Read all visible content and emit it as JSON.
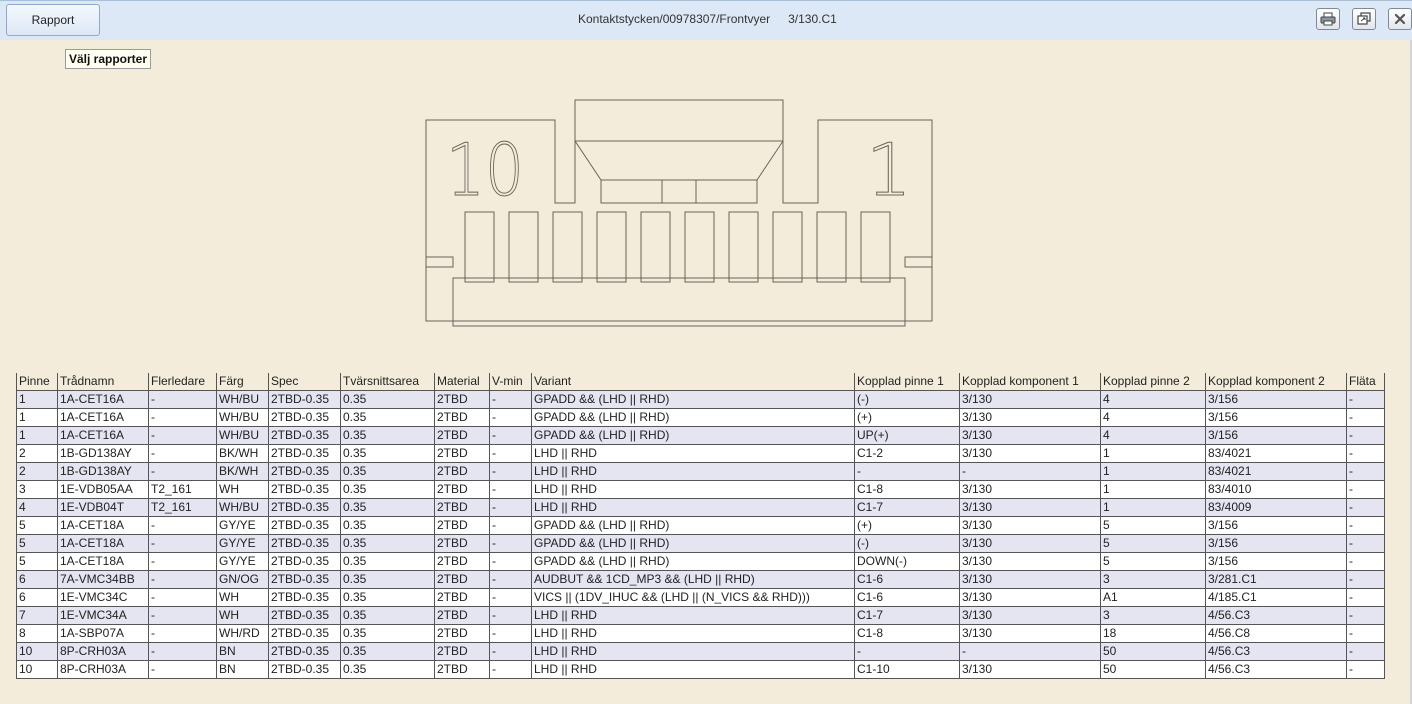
{
  "toolbar": {
    "rapport_label": "Rapport",
    "path": "Kontaktstycken/00978307/Frontvyer",
    "sheet": "3/130.C1",
    "tooltip": "Välj rapporter",
    "icons": [
      "print-icon",
      "restore-window-icon",
      "close-icon"
    ]
  },
  "drawing": {
    "label_left": "10",
    "label_right": "1"
  },
  "table": {
    "columns": [
      "Pinne",
      "Trådnamn",
      "Flerledare",
      "Färg",
      "Spec",
      "Tvärsnittsarea",
      "Material",
      "V-min",
      "Variant",
      "Kopplad pinne 1",
      "Kopplad komponent 1",
      "Kopplad pinne 2",
      "Kopplad komponent 2",
      "Fläta"
    ],
    "rows": [
      [
        "1",
        "1A-CET16A",
        "-",
        "WH/BU",
        "2TBD-0.35",
        "0.35",
        "2TBD",
        "-",
        "GPADD && (LHD || RHD)",
        "(-)",
        "3/130",
        "4",
        "3/156",
        "-"
      ],
      [
        "1",
        "1A-CET16A",
        "-",
        "WH/BU",
        "2TBD-0.35",
        "0.35",
        "2TBD",
        "-",
        "GPADD && (LHD || RHD)",
        "(+)",
        "3/130",
        "4",
        "3/156",
        "-"
      ],
      [
        "1",
        "1A-CET16A",
        "-",
        "WH/BU",
        "2TBD-0.35",
        "0.35",
        "2TBD",
        "-",
        "GPADD && (LHD || RHD)",
        "UP(+)",
        "3/130",
        "4",
        "3/156",
        "-"
      ],
      [
        "2",
        "1B-GD138AY",
        "-",
        "BK/WH",
        "2TBD-0.35",
        "0.35",
        "2TBD",
        "-",
        "LHD || RHD",
        "C1-2",
        "3/130",
        "1",
        "83/4021",
        "-"
      ],
      [
        "2",
        "1B-GD138AY",
        "-",
        "BK/WH",
        "2TBD-0.35",
        "0.35",
        "2TBD",
        "-",
        "LHD || RHD",
        "-",
        "-",
        "1",
        "83/4021",
        "-"
      ],
      [
        "3",
        "1E-VDB05AA",
        "T2_161",
        "WH",
        "2TBD-0.35",
        "0.35",
        "2TBD",
        "-",
        "LHD || RHD",
        "C1-8",
        "3/130",
        "1",
        "83/4010",
        "-"
      ],
      [
        "4",
        "1E-VDB04T",
        "T2_161",
        "WH/BU",
        "2TBD-0.35",
        "0.35",
        "2TBD",
        "-",
        "LHD || RHD",
        "C1-7",
        "3/130",
        "1",
        "83/4009",
        "-"
      ],
      [
        "5",
        "1A-CET18A",
        "-",
        "GY/YE",
        "2TBD-0.35",
        "0.35",
        "2TBD",
        "-",
        "GPADD && (LHD || RHD)",
        "(+)",
        "3/130",
        "5",
        "3/156",
        "-"
      ],
      [
        "5",
        "1A-CET18A",
        "-",
        "GY/YE",
        "2TBD-0.35",
        "0.35",
        "2TBD",
        "-",
        "GPADD && (LHD || RHD)",
        "(-)",
        "3/130",
        "5",
        "3/156",
        "-"
      ],
      [
        "5",
        "1A-CET18A",
        "-",
        "GY/YE",
        "2TBD-0.35",
        "0.35",
        "2TBD",
        "-",
        "GPADD && (LHD || RHD)",
        "DOWN(-)",
        "3/130",
        "5",
        "3/156",
        "-"
      ],
      [
        "6",
        "7A-VMC34BB",
        "-",
        "GN/OG",
        "2TBD-0.35",
        "0.35",
        "2TBD",
        "-",
        "AUDBUT && 1CD_MP3 && (LHD || RHD)",
        "C1-6",
        "3/130",
        "3",
        "3/281.C1",
        "-"
      ],
      [
        "6",
        "1E-VMC34C",
        "-",
        "WH",
        "2TBD-0.35",
        "0.35",
        "2TBD",
        "-",
        "VICS || (1DV_IHUC && (LHD || (N_VICS && RHD)))",
        "C1-6",
        "3/130",
        "A1",
        "4/185.C1",
        "-"
      ],
      [
        "7",
        "1E-VMC34A",
        "-",
        "WH",
        "2TBD-0.35",
        "0.35",
        "2TBD",
        "-",
        "LHD || RHD",
        "C1-7",
        "3/130",
        "3",
        "4/56.C3",
        "-"
      ],
      [
        "8",
        "1A-SBP07A",
        "-",
        "WH/RD",
        "2TBD-0.35",
        "0.35",
        "2TBD",
        "-",
        "LHD || RHD",
        "C1-8",
        "3/130",
        "18",
        "4/56.C8",
        "-"
      ],
      [
        "10",
        "8P-CRH03A",
        "-",
        "BN",
        "2TBD-0.35",
        "0.35",
        "2TBD",
        "-",
        "LHD || RHD",
        "-",
        "-",
        "50",
        "4/56.C3",
        "-"
      ],
      [
        "10",
        "8P-CRH03A",
        "-",
        "BN",
        "2TBD-0.35",
        "0.35",
        "2TBD",
        "-",
        "LHD || RHD",
        "C1-10",
        "3/130",
        "50",
        "4/56.C3",
        "-"
      ]
    ]
  }
}
